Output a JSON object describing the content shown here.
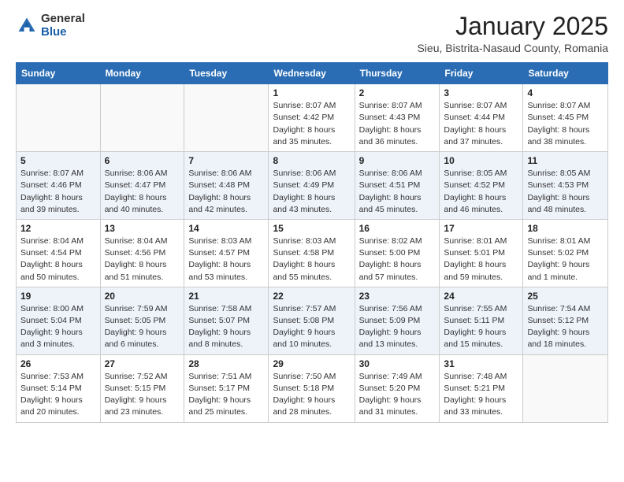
{
  "header": {
    "logo_general": "General",
    "logo_blue": "Blue",
    "month_title": "January 2025",
    "location": "Sieu, Bistrita-Nasaud County, Romania"
  },
  "days_of_week": [
    "Sunday",
    "Monday",
    "Tuesday",
    "Wednesday",
    "Thursday",
    "Friday",
    "Saturday"
  ],
  "weeks": [
    [
      {
        "day": "",
        "info": ""
      },
      {
        "day": "",
        "info": ""
      },
      {
        "day": "",
        "info": ""
      },
      {
        "day": "1",
        "info": "Sunrise: 8:07 AM\nSunset: 4:42 PM\nDaylight: 8 hours and 35 minutes."
      },
      {
        "day": "2",
        "info": "Sunrise: 8:07 AM\nSunset: 4:43 PM\nDaylight: 8 hours and 36 minutes."
      },
      {
        "day": "3",
        "info": "Sunrise: 8:07 AM\nSunset: 4:44 PM\nDaylight: 8 hours and 37 minutes."
      },
      {
        "day": "4",
        "info": "Sunrise: 8:07 AM\nSunset: 4:45 PM\nDaylight: 8 hours and 38 minutes."
      }
    ],
    [
      {
        "day": "5",
        "info": "Sunrise: 8:07 AM\nSunset: 4:46 PM\nDaylight: 8 hours and 39 minutes."
      },
      {
        "day": "6",
        "info": "Sunrise: 8:06 AM\nSunset: 4:47 PM\nDaylight: 8 hours and 40 minutes."
      },
      {
        "day": "7",
        "info": "Sunrise: 8:06 AM\nSunset: 4:48 PM\nDaylight: 8 hours and 42 minutes."
      },
      {
        "day": "8",
        "info": "Sunrise: 8:06 AM\nSunset: 4:49 PM\nDaylight: 8 hours and 43 minutes."
      },
      {
        "day": "9",
        "info": "Sunrise: 8:06 AM\nSunset: 4:51 PM\nDaylight: 8 hours and 45 minutes."
      },
      {
        "day": "10",
        "info": "Sunrise: 8:05 AM\nSunset: 4:52 PM\nDaylight: 8 hours and 46 minutes."
      },
      {
        "day": "11",
        "info": "Sunrise: 8:05 AM\nSunset: 4:53 PM\nDaylight: 8 hours and 48 minutes."
      }
    ],
    [
      {
        "day": "12",
        "info": "Sunrise: 8:04 AM\nSunset: 4:54 PM\nDaylight: 8 hours and 50 minutes."
      },
      {
        "day": "13",
        "info": "Sunrise: 8:04 AM\nSunset: 4:56 PM\nDaylight: 8 hours and 51 minutes."
      },
      {
        "day": "14",
        "info": "Sunrise: 8:03 AM\nSunset: 4:57 PM\nDaylight: 8 hours and 53 minutes."
      },
      {
        "day": "15",
        "info": "Sunrise: 8:03 AM\nSunset: 4:58 PM\nDaylight: 8 hours and 55 minutes."
      },
      {
        "day": "16",
        "info": "Sunrise: 8:02 AM\nSunset: 5:00 PM\nDaylight: 8 hours and 57 minutes."
      },
      {
        "day": "17",
        "info": "Sunrise: 8:01 AM\nSunset: 5:01 PM\nDaylight: 8 hours and 59 minutes."
      },
      {
        "day": "18",
        "info": "Sunrise: 8:01 AM\nSunset: 5:02 PM\nDaylight: 9 hours and 1 minute."
      }
    ],
    [
      {
        "day": "19",
        "info": "Sunrise: 8:00 AM\nSunset: 5:04 PM\nDaylight: 9 hours and 3 minutes."
      },
      {
        "day": "20",
        "info": "Sunrise: 7:59 AM\nSunset: 5:05 PM\nDaylight: 9 hours and 6 minutes."
      },
      {
        "day": "21",
        "info": "Sunrise: 7:58 AM\nSunset: 5:07 PM\nDaylight: 9 hours and 8 minutes."
      },
      {
        "day": "22",
        "info": "Sunrise: 7:57 AM\nSunset: 5:08 PM\nDaylight: 9 hours and 10 minutes."
      },
      {
        "day": "23",
        "info": "Sunrise: 7:56 AM\nSunset: 5:09 PM\nDaylight: 9 hours and 13 minutes."
      },
      {
        "day": "24",
        "info": "Sunrise: 7:55 AM\nSunset: 5:11 PM\nDaylight: 9 hours and 15 minutes."
      },
      {
        "day": "25",
        "info": "Sunrise: 7:54 AM\nSunset: 5:12 PM\nDaylight: 9 hours and 18 minutes."
      }
    ],
    [
      {
        "day": "26",
        "info": "Sunrise: 7:53 AM\nSunset: 5:14 PM\nDaylight: 9 hours and 20 minutes."
      },
      {
        "day": "27",
        "info": "Sunrise: 7:52 AM\nSunset: 5:15 PM\nDaylight: 9 hours and 23 minutes."
      },
      {
        "day": "28",
        "info": "Sunrise: 7:51 AM\nSunset: 5:17 PM\nDaylight: 9 hours and 25 minutes."
      },
      {
        "day": "29",
        "info": "Sunrise: 7:50 AM\nSunset: 5:18 PM\nDaylight: 9 hours and 28 minutes."
      },
      {
        "day": "30",
        "info": "Sunrise: 7:49 AM\nSunset: 5:20 PM\nDaylight: 9 hours and 31 minutes."
      },
      {
        "day": "31",
        "info": "Sunrise: 7:48 AM\nSunset: 5:21 PM\nDaylight: 9 hours and 33 minutes."
      },
      {
        "day": "",
        "info": ""
      }
    ]
  ]
}
